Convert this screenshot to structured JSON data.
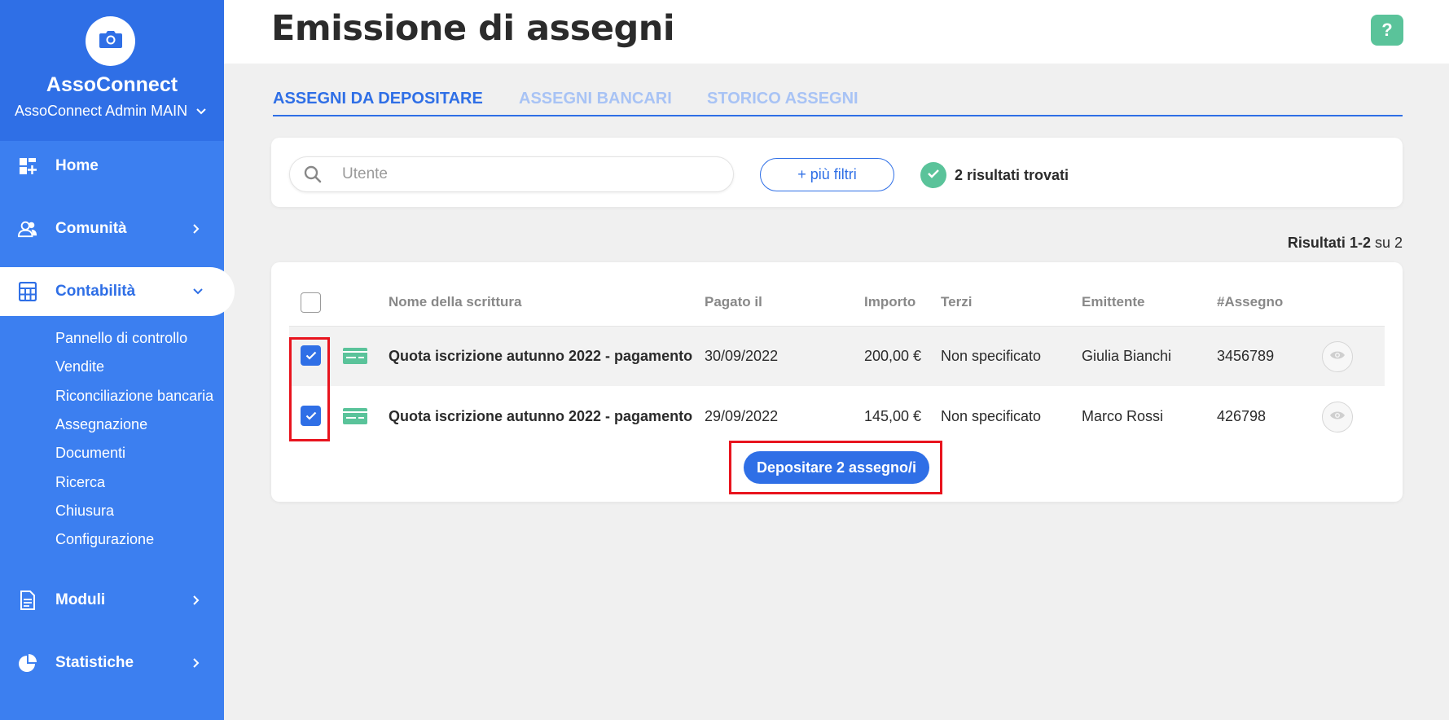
{
  "app": {
    "name": "AssoConnect",
    "account": "AssoConnect Admin MAIN"
  },
  "sidebar": {
    "items": [
      {
        "label": "Home",
        "icon": "dashboard-icon"
      },
      {
        "label": "Comunità",
        "icon": "community-icon"
      },
      {
        "label": "Contabilità",
        "icon": "calculator-icon",
        "active": true
      },
      {
        "label": "Moduli",
        "icon": "document-icon"
      },
      {
        "label": "Statistiche",
        "icon": "chart-icon"
      }
    ],
    "subitems": [
      "Pannello di controllo",
      "Vendite",
      "Riconciliazione bancaria",
      "Assegnazione",
      "Documenti",
      "Ricerca",
      "Chiusura",
      "Configurazione"
    ]
  },
  "header": {
    "title": "Emissione di assegni",
    "help_label": "?"
  },
  "tabs": [
    {
      "label": "ASSEGNI DA DEPOSITARE",
      "active": true
    },
    {
      "label": "ASSEGNI BANCARI",
      "active": false
    },
    {
      "label": "STORICO ASSEGNI",
      "active": false
    }
  ],
  "filters": {
    "search_placeholder": "Utente",
    "more_filters_label": "+ più filtri",
    "results_found": "2 risultati trovati"
  },
  "pagination": {
    "label": "Risultati",
    "range": "1-2",
    "of": "su 2"
  },
  "table": {
    "columns": [
      "Nome della scrittura",
      "Pagato il",
      "Importo",
      "Terzi",
      "Emittente",
      "#Assegno"
    ],
    "rows": [
      {
        "name": "Quota iscrizione autunno 2022 - pagamento",
        "paid_on": "30/09/2022",
        "amount": "200,00 €",
        "third_party": "Non specificato",
        "issuer": "Giulia Bianchi",
        "cheque_no": "3456789",
        "checked": true
      },
      {
        "name": "Quota iscrizione autunno 2022 - pagamento",
        "paid_on": "29/09/2022",
        "amount": "145,00 €",
        "third_party": "Non specificato",
        "issuer": "Marco Rossi",
        "cheque_no": "426798",
        "checked": true
      }
    ]
  },
  "actions": {
    "deposit_label": "Depositare 2 assegno/i"
  },
  "colors": {
    "primary": "#2f6fe6",
    "sidebar": "#3c7ff0",
    "success": "#5ac39a",
    "highlight": "#e8141e"
  }
}
